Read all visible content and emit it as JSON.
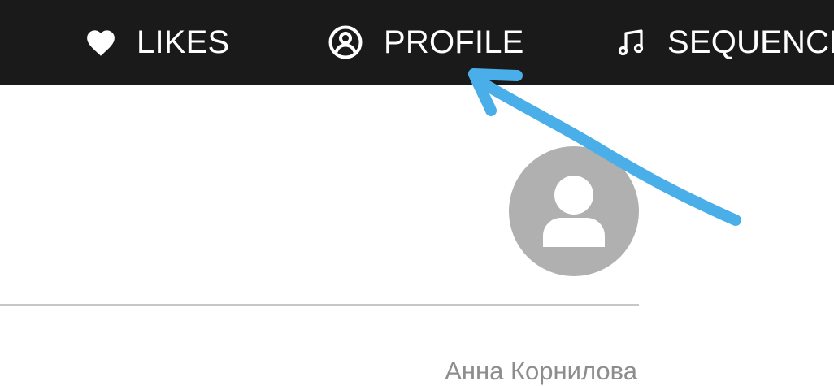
{
  "nav": {
    "tabs": [
      {
        "label": "LIKES",
        "icon": "heart-icon"
      },
      {
        "label": "PROFILE",
        "icon": "user-circle-icon"
      },
      {
        "label": "SEQUENCE",
        "icon": "music-note-icon"
      }
    ]
  },
  "profile": {
    "avatar_icon": "user-silhouette-icon",
    "name": "Анна Корнилова"
  },
  "colors": {
    "nav_background": "#1b1a1a",
    "nav_text": "#ffffff",
    "avatar_background": "#b0b0b0",
    "annotation_arrow": "#4aaee8"
  }
}
